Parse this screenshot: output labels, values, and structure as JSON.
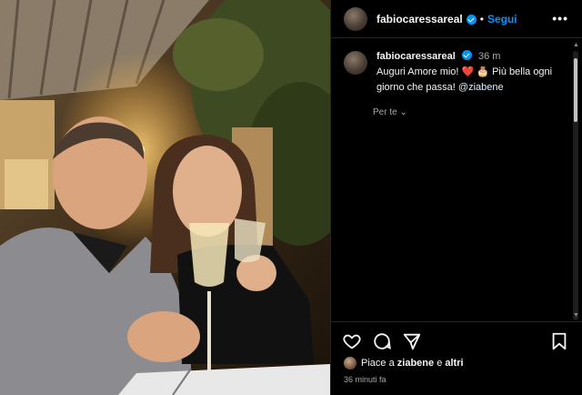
{
  "post": {
    "username": "fabiocaressareal",
    "follow_label": "Segui",
    "separator": "•",
    "more_label": "•••",
    "caption_time": "36 m",
    "caption_text": "Auguri Amore mio!",
    "caption_emojis": "❤️ 🎂",
    "caption_text2": "Più bella ogni giorno che passa!",
    "caption_mention": "@ziabene",
    "for_you_label": "Per te",
    "likes_prefix": "Piace a",
    "likes_user": "ziabene",
    "likes_conj": "e",
    "likes_others": "altri",
    "posted_ago": "36 minuti fa"
  },
  "icons": {
    "like": "heart-icon",
    "comment": "comment-icon",
    "share": "share-icon",
    "save": "bookmark-icon",
    "verified": "verified-badge-icon",
    "more": "more-options-icon"
  },
  "colors": {
    "accent": "#0095f6",
    "background": "#000000",
    "text": "#f5f5f5",
    "muted": "#a8a8a8"
  }
}
